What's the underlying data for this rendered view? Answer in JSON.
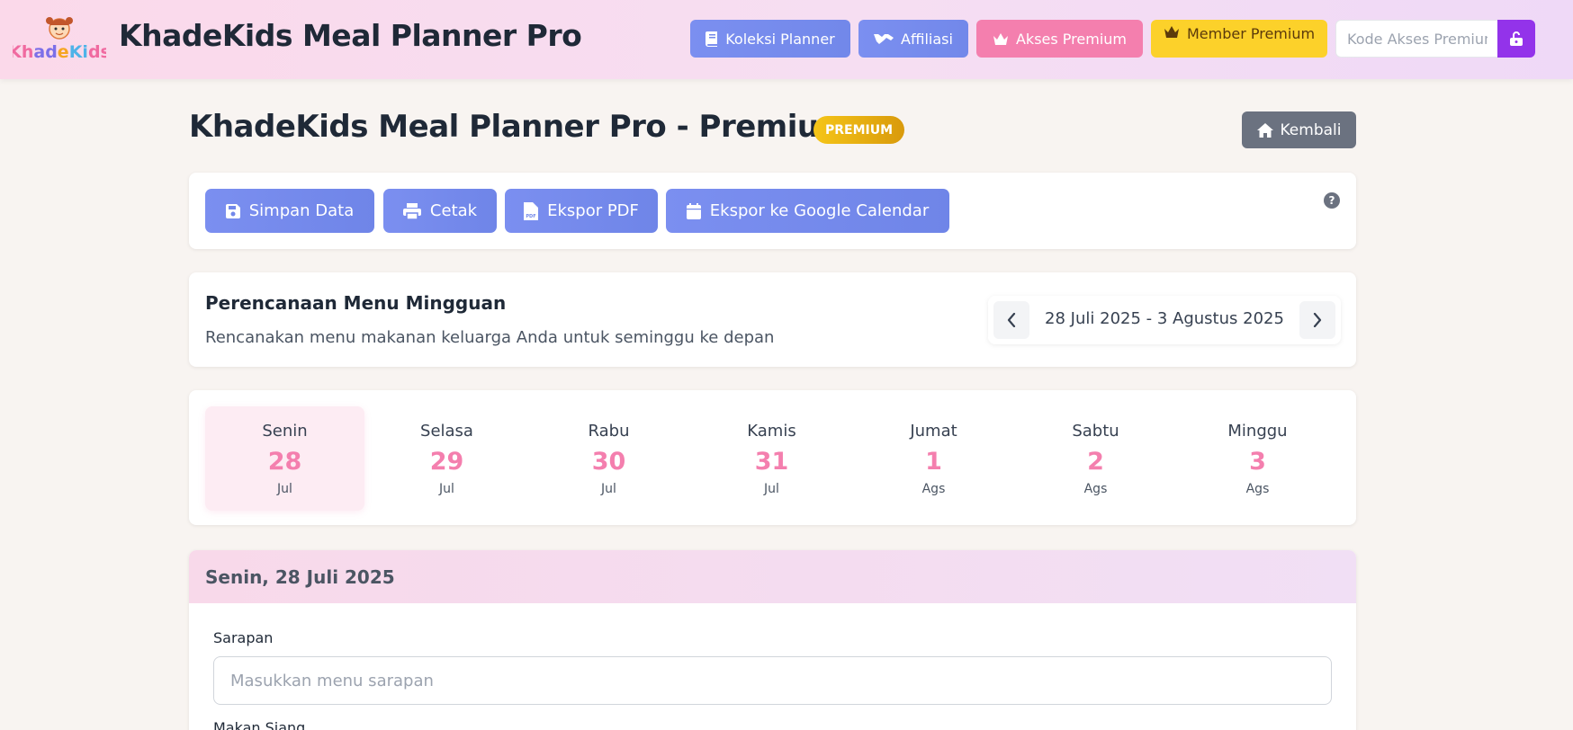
{
  "header": {
    "logo_text": "KhadeKids",
    "app_title": "KhadeKids Meal Planner Pro",
    "nav": {
      "koleksi": "Koleksi Planner",
      "affiliasi": "Affiliasi",
      "akses": "Akses Premium",
      "member": "Member Premium"
    },
    "code_placeholder": "Kode Akses Premium"
  },
  "page": {
    "title": "KhadeKids Meal Planner Pro - Premium",
    "badge": "PREMIUM",
    "back_label": "Kembali"
  },
  "toolbar": {
    "save": "Simpan Data",
    "print": "Cetak",
    "pdf": "Ekspor PDF",
    "gcal": "Ekspor ke Google Calendar",
    "help": "?"
  },
  "planner": {
    "title": "Perencanaan Menu Mingguan",
    "subtitle": "Rencanakan menu makanan keluarga Anda untuk seminggu ke depan",
    "week_range": "28 Juli 2025 - 3 Agustus 2025"
  },
  "days": [
    {
      "name": "Senin",
      "num": "28",
      "month": "Jul"
    },
    {
      "name": "Selasa",
      "num": "29",
      "month": "Jul"
    },
    {
      "name": "Rabu",
      "num": "30",
      "month": "Jul"
    },
    {
      "name": "Kamis",
      "num": "31",
      "month": "Jul"
    },
    {
      "name": "Jumat",
      "num": "1",
      "month": "Ags"
    },
    {
      "name": "Sabtu",
      "num": "2",
      "month": "Ags"
    },
    {
      "name": "Minggu",
      "num": "3",
      "month": "Ags"
    }
  ],
  "selected_day": "Senin",
  "meal": {
    "date_title": "Senin, 28 Juli 2025",
    "breakfast_label": "Sarapan",
    "breakfast_placeholder": "Masukkan menu sarapan",
    "breakfast_value": "",
    "lunch_label": "Makan Siang"
  },
  "colors": {
    "accent_pink": "#f47fae",
    "accent_blue": "#7288ea",
    "accent_purple": "#9333ea",
    "accent_yellow": "#fcd12a"
  }
}
